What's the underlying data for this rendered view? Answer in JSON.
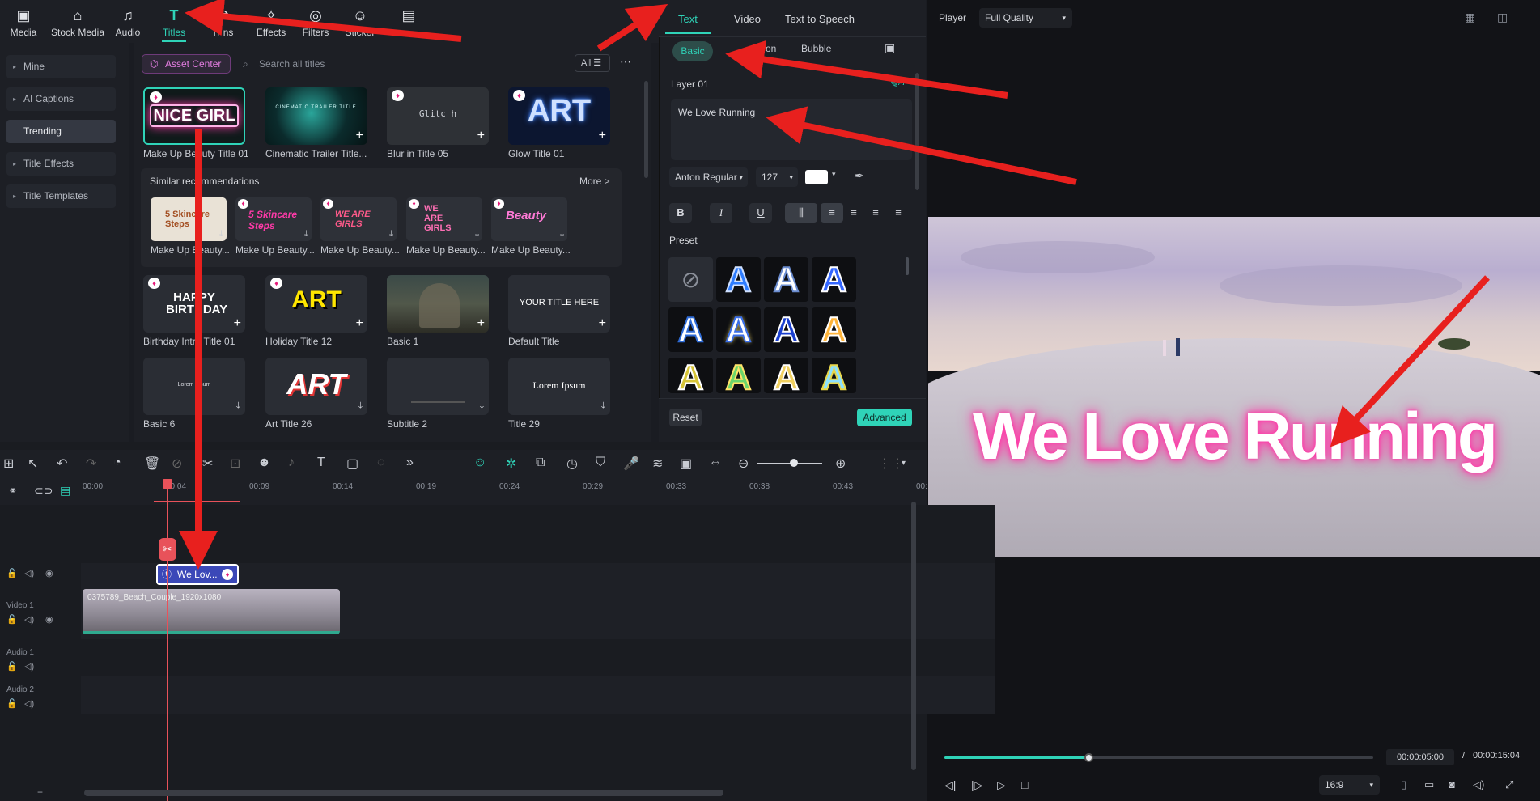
{
  "toolbar": {
    "tabs": [
      {
        "label": "Media",
        "icon": "media-icon"
      },
      {
        "label": "Stock Media",
        "icon": "stock-media-icon"
      },
      {
        "label": "Audio",
        "icon": "audio-icon"
      },
      {
        "label": "Titles",
        "icon": "titles-icon"
      },
      {
        "label": "Tr  ns",
        "icon": "transitions-icon"
      },
      {
        "label": "Effects",
        "icon": "effects-icon"
      },
      {
        "label": "Filters",
        "icon": "filters-icon"
      },
      {
        "label": "Sticker",
        "icon": "stickers-icon"
      },
      {
        "label": "",
        "icon": "templates-icon"
      }
    ],
    "active_tab": "Titles",
    "accent_color": "#2fd3b8"
  },
  "sidebar": {
    "items": [
      {
        "label": "Mine"
      },
      {
        "label": "AI Captions"
      },
      {
        "label": "Trending"
      },
      {
        "label": "Title Effects"
      },
      {
        "label": "Title Templates"
      }
    ],
    "active": "Trending"
  },
  "library": {
    "asset_center": "Asset Center",
    "search_placeholder": "Search all titles",
    "filter_label": "All",
    "row1": [
      {
        "caption": "Make Up Beauty Title 01",
        "thumb_text": "NICE GIRL"
      },
      {
        "caption": "Cinematic Trailer Title...",
        "thumb_text": "CINEMATIC TRAILER TITLE"
      },
      {
        "caption": "Blur in Title 05",
        "thumb_text": "Glitc h"
      },
      {
        "caption": "Glow Title 01",
        "thumb_text": "ART"
      }
    ],
    "similar": {
      "heading": "Similar recommendations",
      "more": "More >",
      "items": [
        {
          "caption": "Make Up Beauty...",
          "thumb_text": "5 Skincare Steps"
        },
        {
          "caption": "Make Up Beauty...",
          "thumb_text": "5 Skincare Steps"
        },
        {
          "caption": "Make Up Beauty...",
          "thumb_text": "WE ARE GIRLS"
        },
        {
          "caption": "Make Up Beauty...",
          "thumb_text": "WE ARE GIRLS"
        },
        {
          "caption": "Make Up Beauty...",
          "thumb_text": "Beauty"
        }
      ]
    },
    "row3": [
      {
        "caption": "Birthday Intro Title 01",
        "thumb_text": "HAPPY BIRTHDAY"
      },
      {
        "caption": "Holiday Title 12",
        "thumb_text": "ART"
      },
      {
        "caption": "Basic 1",
        "thumb_text": ""
      },
      {
        "caption": "Default Title",
        "thumb_text": "YOUR TITLE HERE"
      }
    ],
    "row4": [
      {
        "caption": "Basic 6",
        "thumb_text": "Lorem Ipsum"
      },
      {
        "caption": "Art Title 26",
        "thumb_text": "ART"
      },
      {
        "caption": "Subtitle 2",
        "thumb_text": ""
      },
      {
        "caption": "Title 29",
        "thumb_text": "Lorem Ipsum"
      }
    ]
  },
  "settings": {
    "tabs": [
      "Text",
      "Video",
      "Text to Speech"
    ],
    "active_tab": "Text",
    "subtabs": [
      "Basic",
      "Animation",
      "Bubble"
    ],
    "subtab_visible": [
      "Basic",
      "on",
      "Bubble"
    ],
    "layer_label": "Layer 01",
    "text_value": "We Love Running",
    "font": "Anton Regular",
    "font_size": "127",
    "color_swatch": "#ffffff",
    "format_buttons": [
      "B",
      "I",
      "U"
    ],
    "preset_label": "Preset",
    "reset": "Reset",
    "advanced": "Advanced"
  },
  "player": {
    "label": "Player",
    "quality": "Full Quality",
    "overlay_text": "We Love Running",
    "overlay_color": "#ff3aa8",
    "current_time": "00:00:05:00",
    "separator": "/",
    "total_time": "00:00:15:04",
    "aspect": "16:9",
    "progress": 0.335
  },
  "timeline": {
    "ticks": [
      "00:00",
      "00:04",
      "00:09",
      "00:14",
      "00:19",
      "00:24",
      "00:29",
      "00:33",
      "00:38",
      "00:43",
      "00:"
    ],
    "title_clip": "We Lov...",
    "video_clip": "0375789_Beach_Couple_1920x1080",
    "tracks": [
      "Video 1",
      "Audio 1",
      "Audio 2"
    ]
  }
}
